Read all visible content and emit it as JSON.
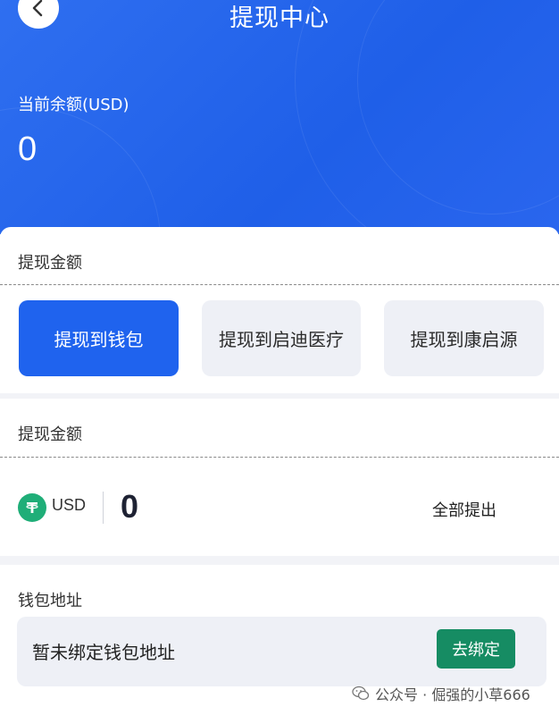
{
  "header": {
    "title": "提现中心",
    "balance_label": "当前余额(USD)",
    "balance_value": "0"
  },
  "withdraw_target": {
    "label": "提现金额",
    "options": [
      {
        "label": "提现到钱包",
        "active": true
      },
      {
        "label": "提现到启迪医疗",
        "active": false
      },
      {
        "label": "提现到康启源",
        "active": false
      }
    ]
  },
  "amount": {
    "label": "提现金额",
    "currency": "USD",
    "value": "0",
    "withdraw_all_label": "全部提出"
  },
  "wallet": {
    "label": "钱包地址",
    "status_text": "暂未绑定钱包地址",
    "bind_label": "去绑定"
  },
  "watermark": {
    "text": "公众号 · 倔强的小草666"
  },
  "colors": {
    "primary": "#1f63ee",
    "bind_button": "#168c63",
    "coin": "#1fae78"
  },
  "icons": {
    "back": "chevron-left-icon",
    "coin": "usdt-coin-icon",
    "watermark": "wechat-icon"
  }
}
